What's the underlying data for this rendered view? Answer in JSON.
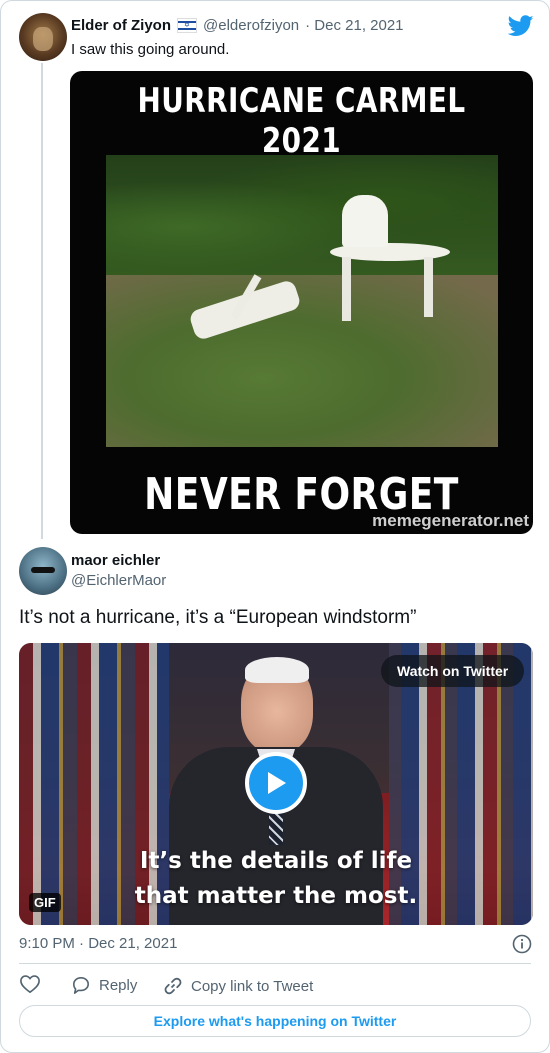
{
  "quoted_tweet": {
    "author_name": "Elder of Ziyon",
    "flag_icon": "israel-flag-icon",
    "handle": "@elderofziyon",
    "date": "· Dec 21, 2021",
    "text": "I saw this going around.",
    "meme": {
      "top_text": "HURRICANE CARMEL 2021",
      "bottom_text": "NEVER FORGET",
      "watermark": "memegenerator.net"
    }
  },
  "tweet": {
    "author_name": "maor eichler",
    "handle": "@EichlerMaor",
    "text": "It’s not a hurricane, it’s a “European windstorm”",
    "video": {
      "watch_label": "Watch on Twitter",
      "gif_label": "GIF",
      "caption_line1": "It’s the details of life",
      "caption_line2": "that matter the most."
    },
    "timestamp": "9:10 PM · Dec 21, 2021"
  },
  "actions": {
    "reply_label": "Reply",
    "copy_link_label": "Copy link to Tweet"
  },
  "explore_label": "Explore what's happening on Twitter",
  "colors": {
    "accent": "#1d9bf0",
    "muted": "#536471",
    "border": "#cfd9de"
  }
}
